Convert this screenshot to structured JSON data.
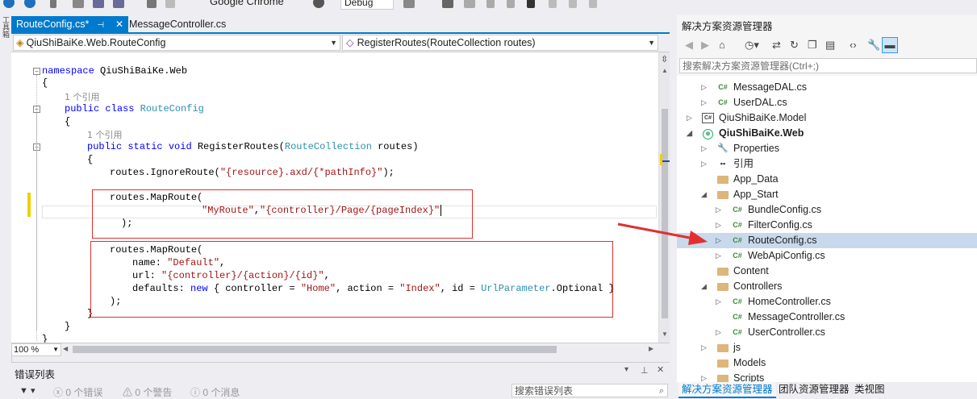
{
  "toolbar": {
    "browser_label": "Google Chrome",
    "config_label": "Debug"
  },
  "left_strip": {
    "label": "工具箱"
  },
  "tabs": [
    {
      "label": "RouteConfig.cs*",
      "active": true
    },
    {
      "label": "MessageController.cs",
      "active": false
    }
  ],
  "nav": {
    "class_combo": "QiuShiBaiKe.Web.RouteConfig",
    "member_combo": "RegisterRoutes(RouteCollection routes)"
  },
  "code": {
    "l1_kw": "namespace",
    "l1_rest": " QiuShiBaiKe.Web",
    "l2": "{",
    "ref1": "1 个引用",
    "l3_kw1": "public",
    "l3_kw2": "class",
    "l3_ty": "RouteConfig",
    "l4": "{",
    "ref2": "1 个引用",
    "l5_kw1": "public",
    "l5_kw2": "static",
    "l5_kw3": "void",
    "l5_name": " RegisterRoutes(",
    "l5_ty": "RouteCollection",
    "l5_rest": " routes)",
    "l6": "{",
    "l7_pre": "routes.IgnoreRoute(",
    "l7_str": "\"{resource}.axd/{*pathInfo}\"",
    "l7_post": ");",
    "l8": "routes.MapRoute(",
    "l9_str1": "\"MyRoute\"",
    "l9_comma": ",",
    "l9_str2": "\"{controller}/Page/{pageIndex}\"",
    "l10": ");",
    "l11": "routes.MapRoute(",
    "l12_pre": "name: ",
    "l12_str": "\"Default\"",
    "l12_post": ",",
    "l13_pre": "url: ",
    "l13_str": "\"{controller}/{action}/{id}\"",
    "l13_post": ",",
    "l14_pre": "defaults: ",
    "l14_kw": "new",
    "l14_a": " { controller = ",
    "l14_s1": "\"Home\"",
    "l14_b": ", action = ",
    "l14_s2": "\"Index\"",
    "l14_c": ", id = ",
    "l14_ty": "UrlParameter",
    "l14_d": ".Optional }",
    "l15": ");",
    "l16": "}",
    "l17": "}",
    "l18": "}"
  },
  "zoom": "100 %",
  "error_panel": {
    "title": "错误列表",
    "errors": "0 个错误",
    "warnings": "0 个警告",
    "messages": "0 个消息",
    "search_placeholder": "搜索错误列表"
  },
  "solution_explorer": {
    "title": "解决方案资源管理器",
    "search_placeholder": "搜索解决方案资源管理器(Ctrl+;)",
    "items": [
      {
        "label": "MessageDAL.cs",
        "icon": "cs"
      },
      {
        "label": "UserDAL.cs",
        "icon": "cs"
      },
      {
        "label": "QiuShiBaiKe.Model",
        "icon": "proj"
      },
      {
        "label": "QiuShiBaiKe.Web",
        "icon": "web"
      },
      {
        "label": "Properties",
        "icon": "wrench"
      },
      {
        "label": "引用",
        "icon": "ref"
      },
      {
        "label": "App_Data",
        "icon": "folder"
      },
      {
        "label": "App_Start",
        "icon": "folder"
      },
      {
        "label": "BundleConfig.cs",
        "icon": "cs"
      },
      {
        "label": "FilterConfig.cs",
        "icon": "cs"
      },
      {
        "label": "RouteConfig.cs",
        "icon": "cs"
      },
      {
        "label": "WebApiConfig.cs",
        "icon": "cs"
      },
      {
        "label": "Content",
        "icon": "folder"
      },
      {
        "label": "Controllers",
        "icon": "folder"
      },
      {
        "label": "HomeController.cs",
        "icon": "cs"
      },
      {
        "label": "MessageController.cs",
        "icon": "cs"
      },
      {
        "label": "UserController.cs",
        "icon": "cs"
      },
      {
        "label": "js",
        "icon": "folder"
      },
      {
        "label": "Models",
        "icon": "folder"
      },
      {
        "label": "Scripts",
        "icon": "folder"
      }
    ],
    "icon_cs_text": "C#",
    "icon_proj_text": "C#",
    "icon_web_text": "⊕",
    "icon_wrench_text": "🔧",
    "icon_ref_text": "▪▪",
    "bottom_tabs": [
      "解决方案资源管理器",
      "团队资源管理器",
      "类视图"
    ]
  },
  "colors": {
    "accent": "#007acc",
    "annotation_red": "#e03030",
    "keyword": "#0000ff",
    "type": "#2b91af",
    "string": "#a31515"
  }
}
